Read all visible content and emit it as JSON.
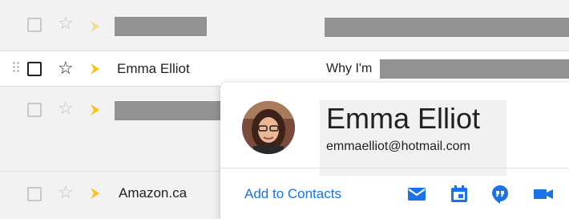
{
  "rows": [
    {
      "sender": "",
      "subject": ""
    },
    {
      "sender": "Emma Elliot",
      "subject": "Why I'm"
    },
    {
      "sender": "",
      "subject": ""
    },
    {
      "sender": "Amazon.ca",
      "subject": ""
    }
  ],
  "hover_card": {
    "name": "Emma Elliot",
    "email": "emmaelliot@hotmail.com",
    "add_to_contacts": "Add to Contacts",
    "actions": [
      "mail-icon",
      "calendar-icon",
      "chat-icon",
      "video-icon"
    ]
  },
  "colors": {
    "accent": "#1a73e8",
    "important_marker": "#f7c21b",
    "redaction": "#929292"
  }
}
